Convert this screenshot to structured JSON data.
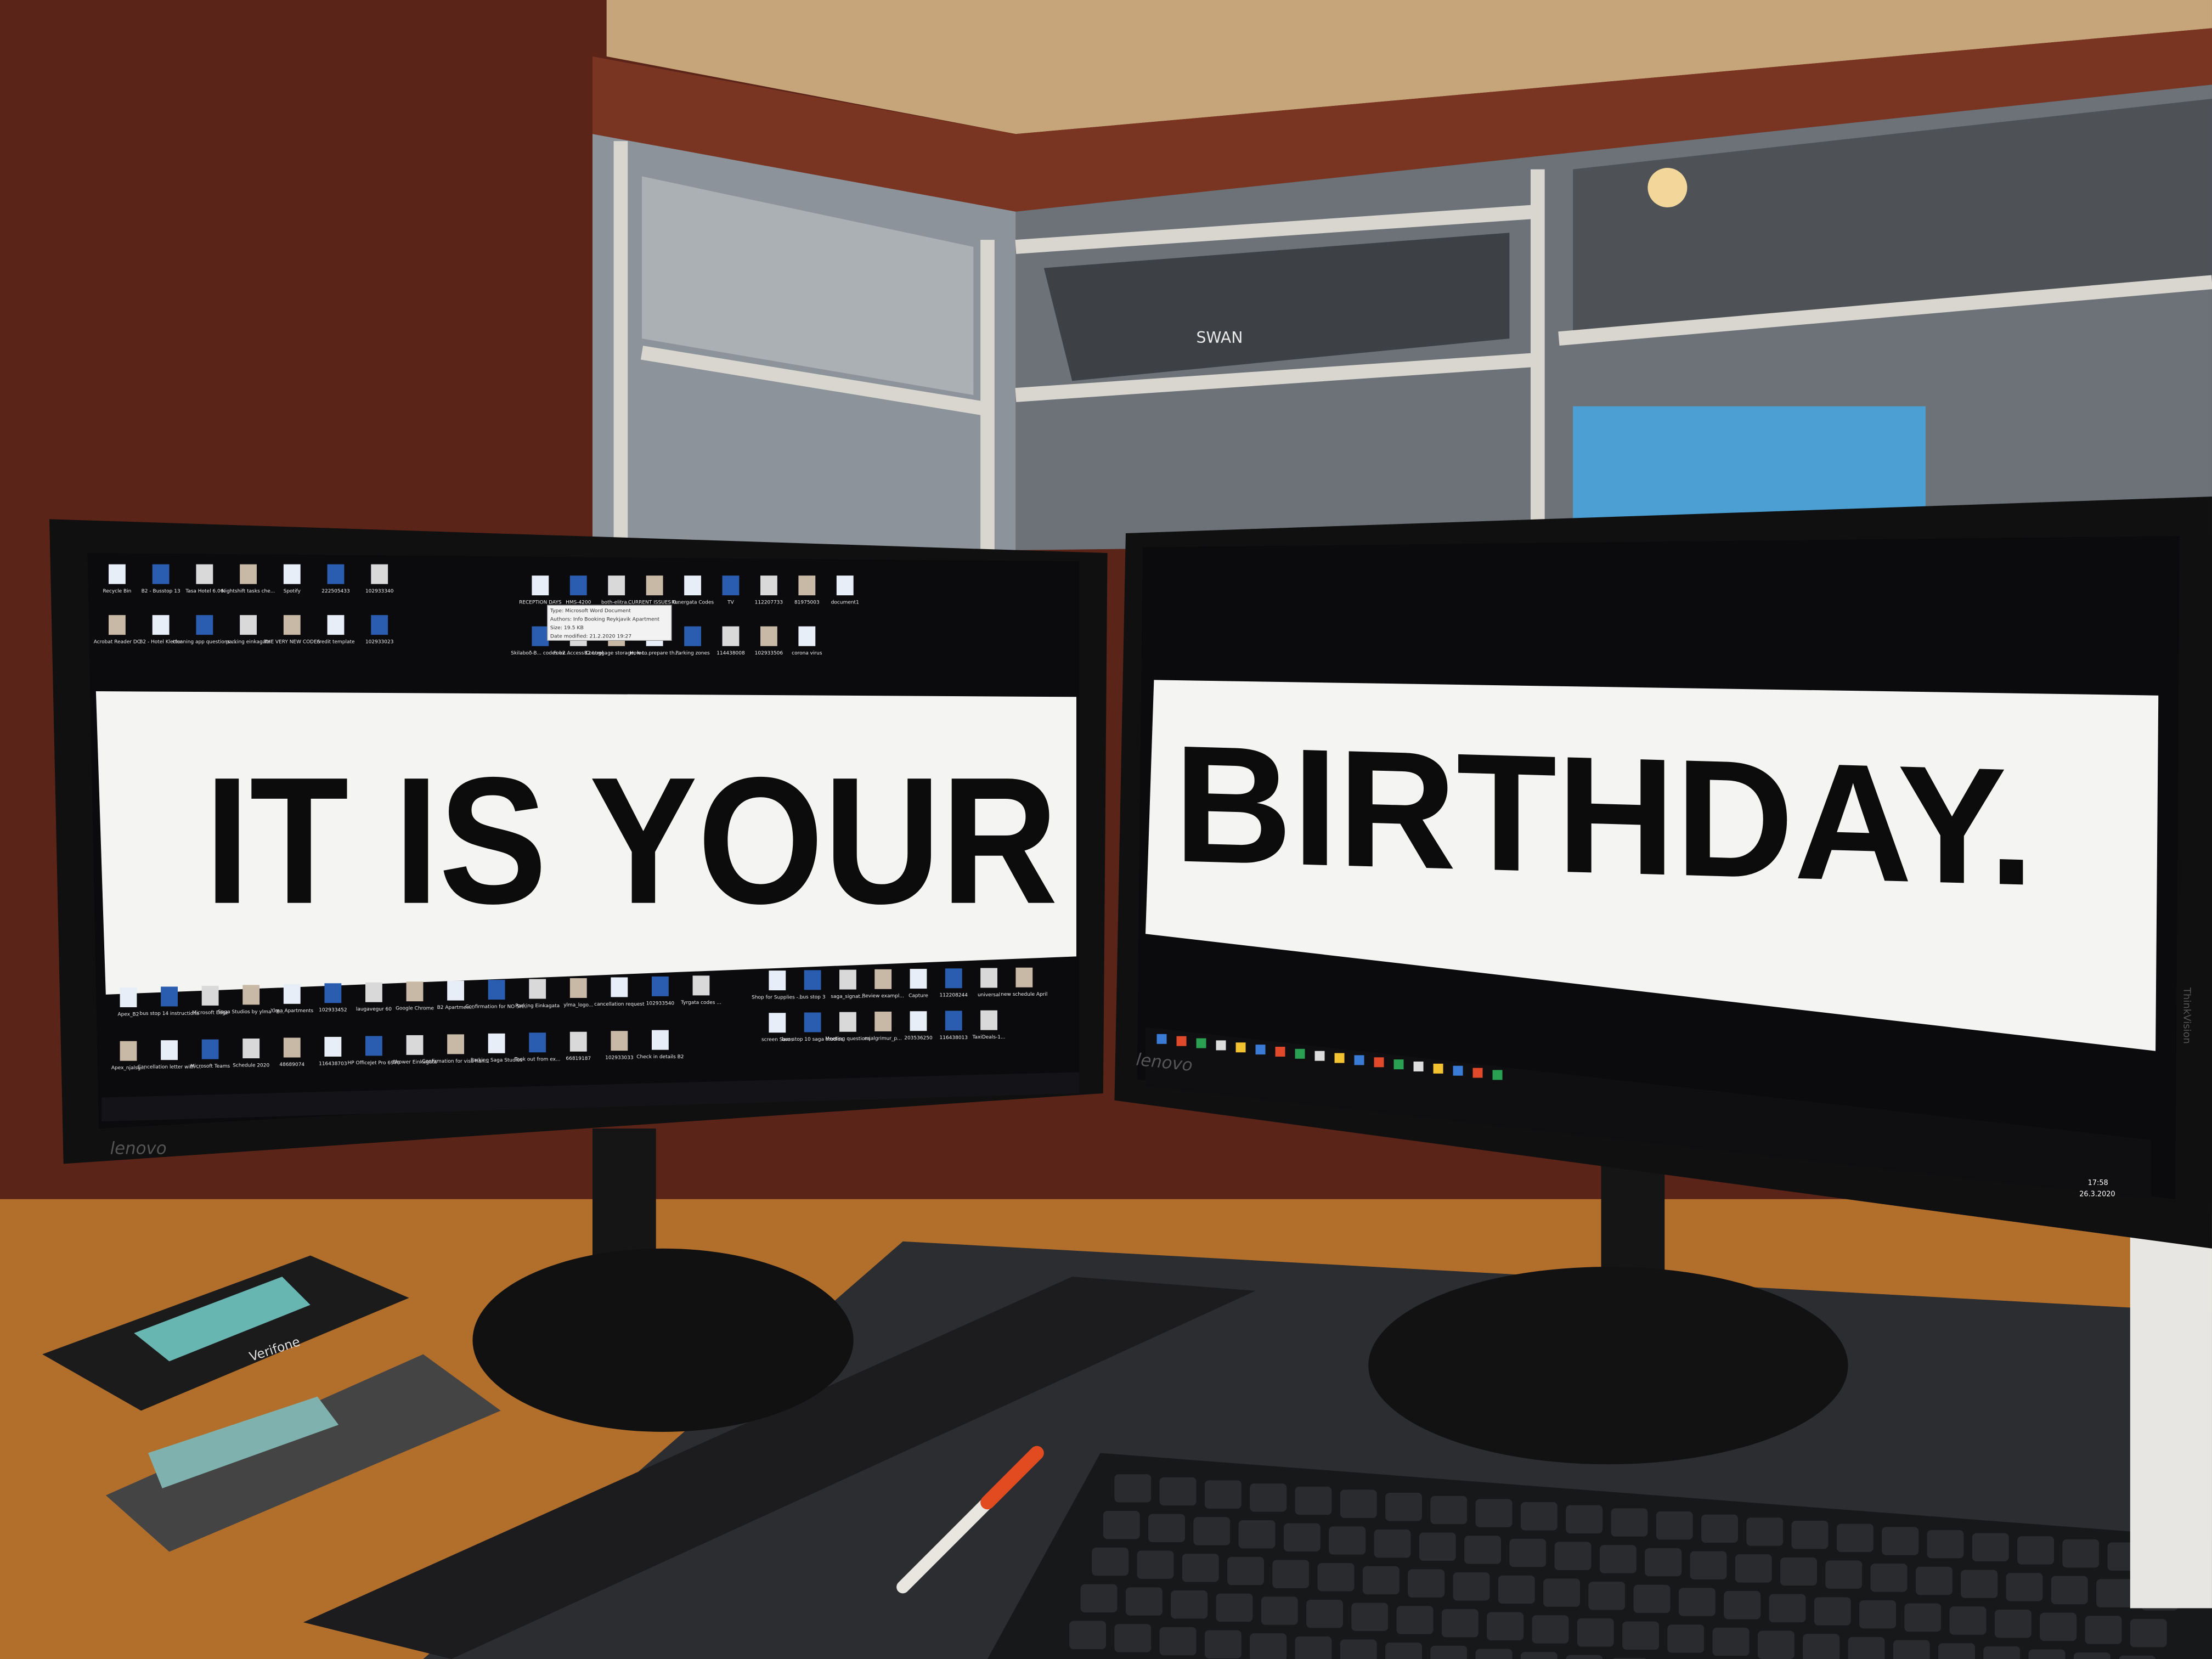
{
  "left_screen": {
    "banner_text": "IT IS YOUR",
    "icons_top": [
      "Recycle Bin",
      "B2 - Busstop 13",
      "Tasa Hotel 6.06",
      "Nightshift tasks che...",
      "Spotify",
      "222505433",
      "102933340",
      "Acrobat Reader DC",
      "B2 - Hotel Klettur",
      "cleaning app questions ...",
      "parking einkagata",
      "THE VERY NEW CODES",
      "credit template",
      "102933023"
    ],
    "icons_top_right": [
      "RECEPTION DAYS",
      "HMS-4200",
      "both-elitra...",
      "CURRENT ISSUES O...",
      "Runergata Codes",
      "TV",
      "112207733",
      "81975003",
      "document1",
      "Skilaboð-B... codes ex...",
      "Fob2 Access Control",
      "B2 Luggage storage, loc...",
      "How to prepare th...",
      "Parking zones",
      "114438008",
      "102933506",
      "corona virus"
    ],
    "tooltip": [
      "Type: Microsoft Word Document",
      "Authors: Info Booking Reykjavik Apartment",
      "Size: 19.5 KB",
      "Date modified: 21.2.2020 19:27"
    ],
    "icons_bottom": [
      "Apex_B2",
      "bus stop 14 instructions",
      "Microsoft Edge",
      "Saga Studios by ylma - B...",
      "Ylma Apartments",
      "102933452",
      "laugavegur 60",
      "Google Chrome",
      "B2 Apartmen...",
      "Confirmation for NO SH...",
      "Parking Einkagata",
      "ylma_logo...",
      "cancellation request",
      "102933540",
      "Tyrgata codes ...",
      "Apex_njalsg...",
      "Cancellation letter with ...",
      "Microsoft Teams",
      "Schedule 2020",
      "48689074",
      "116438703",
      "HP OfficeJet Pro 6970",
      "Shower Einkagata",
      "Confirmation for visa han...",
      "Parking Saga Studios",
      "Took out from ex...",
      "66819187",
      "102933033",
      "Check in details B2"
    ],
    "icons_bottom_right": [
      "Shop for Supplies -...",
      "bus stop 3",
      "saga_signat...",
      "Review exampl...",
      "Capture",
      "112208244",
      "universal",
      "new schedule April",
      "screen Saros",
      "bus stop 10 saga studios",
      "Meeting questions",
      "mjalgrimur_p...",
      "203536250",
      "116438013",
      "TaxiDeals-1..."
    ]
  },
  "right_screen": {
    "banner_text": "BIRTHDAY.",
    "clock_time": "17:58",
    "clock_date": "26.3.2020"
  },
  "monitor_brand": "lenovo",
  "monitor_model": "ThinkVision",
  "window_sign": "SWAN",
  "terminal_brand": "Verifone",
  "colors": {
    "wall": "#6b2a1c",
    "desk": "#b8742e",
    "screen_black": "#0b0a0c",
    "banner": "#f4f4f2",
    "ceiling": "#c9a77a"
  }
}
